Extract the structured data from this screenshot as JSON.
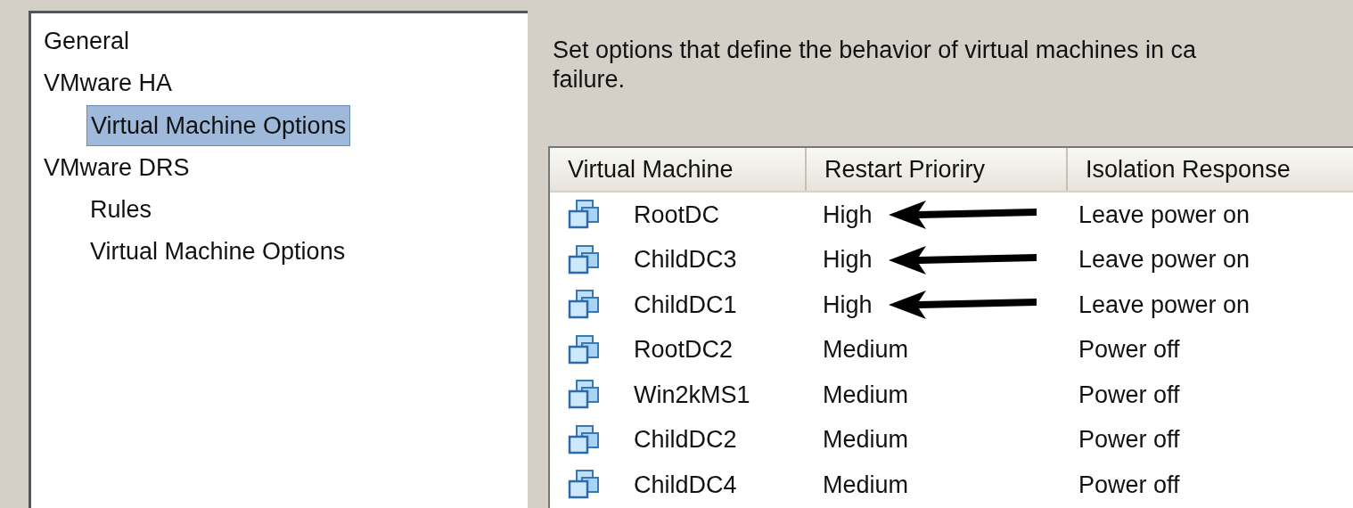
{
  "tree": {
    "items": [
      {
        "label": "General",
        "selected": false
      },
      {
        "label": "VMware HA",
        "selected": false,
        "children": [
          {
            "label": "Virtual Machine Options",
            "selected": true
          }
        ]
      },
      {
        "label": "VMware DRS",
        "selected": false,
        "children": [
          {
            "label": "Rules",
            "selected": false
          },
          {
            "label": "Virtual Machine Options",
            "selected": false
          }
        ]
      }
    ]
  },
  "description": {
    "lines": [
      "Set options that define the behavior of virtual machines in ca",
      "failure."
    ]
  },
  "table": {
    "columns": [
      "Virtual Machine",
      "Restart Prioriry",
      "Isolation Response"
    ],
    "rows": [
      {
        "name": "RootDC",
        "priority": "High",
        "response": "Leave power on",
        "arrow": true
      },
      {
        "name": "ChildDC3",
        "priority": "High",
        "response": "Leave power on",
        "arrow": true
      },
      {
        "name": "ChildDC1",
        "priority": "High",
        "response": "Leave power on",
        "arrow": true
      },
      {
        "name": "RootDC2",
        "priority": "Medium",
        "response": "Power off",
        "arrow": false
      },
      {
        "name": "Win2kMS1",
        "priority": "Medium",
        "response": "Power off",
        "arrow": false
      },
      {
        "name": "ChildDC2",
        "priority": "Medium",
        "response": "Power off",
        "arrow": false
      },
      {
        "name": "ChildDC4",
        "priority": "Medium",
        "response": "Power off",
        "arrow": false
      }
    ]
  }
}
